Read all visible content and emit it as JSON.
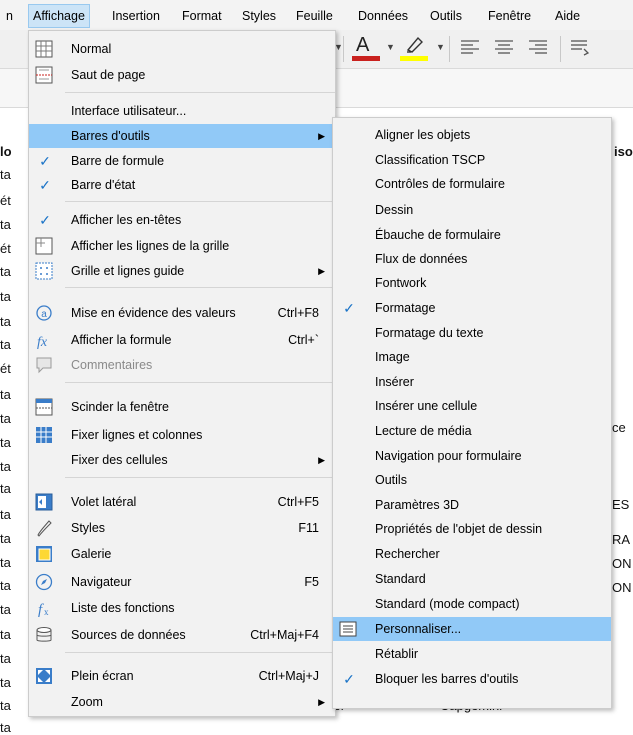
{
  "menubar": {
    "items": [
      "n",
      "Affichage",
      "Insertion",
      "Format",
      "Styles",
      "Feuille",
      "Données",
      "Outils",
      "Fenêtre",
      "Aide"
    ]
  },
  "sheet": {
    "col_header_fragments": [
      "lo",
      "iso"
    ],
    "left_fragments": [
      "ta",
      "ét",
      "ta",
      "ét",
      "ta",
      "ta",
      "ta",
      "ta",
      "ét",
      "ta",
      "ta",
      "ta",
      "ta",
      "ta",
      "ta",
      "ta",
      "ta",
      "ta",
      "ta",
      "ta",
      "ta",
      "ta",
      "ta",
      "ta",
      "ta"
    ],
    "right_fragments": [
      "ce",
      "ES",
      "RA",
      "ON",
      "ON"
    ],
    "bottom_fragments": [
      "raer",
      "Capgemini"
    ]
  },
  "affichage_menu": {
    "items": [
      {
        "label": "Normal",
        "accel": "",
        "icon": "normal-view-icon"
      },
      {
        "label": "Saut de page",
        "accel": "",
        "icon": "page-break-icon"
      },
      {
        "label": "Interface utilisateur...",
        "accel": ""
      },
      {
        "label": "Barres d'outils",
        "accel": "",
        "submenu": true,
        "highlight": true
      },
      {
        "label": "Barre de formule",
        "accel": "",
        "checked": true
      },
      {
        "label": "Barre d'état",
        "accel": "",
        "checked": true
      },
      {
        "label": "Afficher les en-têtes",
        "accel": "",
        "checked": true
      },
      {
        "label": "Afficher les lignes de la grille",
        "accel": "",
        "icon": "grid-lines-icon"
      },
      {
        "label": "Grille et lignes guide",
        "accel": "",
        "icon": "grid-guide-icon",
        "submenu": true
      },
      {
        "label": "Mise en évidence des valeurs",
        "accel": "Ctrl+F8",
        "icon": "value-highlight-icon"
      },
      {
        "label": "Afficher la formule",
        "accel": "Ctrl+`",
        "icon": "formula-icon"
      },
      {
        "label": "Commentaires",
        "accel": "",
        "icon": "comment-icon",
        "disabled": true
      },
      {
        "label": "Scinder la fenêtre",
        "accel": "",
        "icon": "split-window-icon"
      },
      {
        "label": "Fixer lignes et colonnes",
        "accel": "",
        "icon": "freeze-icon"
      },
      {
        "label": "Fixer des cellules",
        "accel": "",
        "submenu": true
      },
      {
        "label": "Volet latéral",
        "accel": "Ctrl+F5",
        "icon": "sidebar-icon"
      },
      {
        "label": "Styles",
        "accel": "F11",
        "icon": "styles-icon"
      },
      {
        "label": "Galerie",
        "accel": "",
        "icon": "gallery-icon"
      },
      {
        "label": "Navigateur",
        "accel": "F5",
        "icon": "navigator-icon"
      },
      {
        "label": "Liste des fonctions",
        "accel": "",
        "icon": "function-list-icon"
      },
      {
        "label": "Sources de données",
        "accel": "Ctrl+Maj+F4",
        "icon": "data-sources-icon"
      },
      {
        "label": "Plein écran",
        "accel": "Ctrl+Maj+J",
        "icon": "fullscreen-icon"
      },
      {
        "label": "Zoom",
        "accel": "",
        "submenu": true
      }
    ]
  },
  "toolbars_submenu": {
    "items": [
      {
        "label": "Aligner les objets"
      },
      {
        "label": "Classification TSCP"
      },
      {
        "label": "Contrôles de formulaire"
      },
      {
        "label": "Dessin"
      },
      {
        "label": "Ébauche de formulaire"
      },
      {
        "label": "Flux de données"
      },
      {
        "label": "Fontwork"
      },
      {
        "label": "Formatage",
        "checked": true
      },
      {
        "label": "Formatage du texte"
      },
      {
        "label": "Image"
      },
      {
        "label": "Insérer"
      },
      {
        "label": "Insérer une cellule"
      },
      {
        "label": "Lecture de média"
      },
      {
        "label": "Navigation pour formulaire"
      },
      {
        "label": "Outils"
      },
      {
        "label": "Paramètres 3D"
      },
      {
        "label": "Propriétés de l'objet de dessin"
      },
      {
        "label": "Rechercher"
      },
      {
        "label": "Standard"
      },
      {
        "label": "Standard (mode compact)"
      },
      {
        "label": "Personnaliser...",
        "highlight": true,
        "icon": "customize-icon"
      },
      {
        "label": "Rétablir"
      },
      {
        "label": "Bloquer les barres d'outils",
        "checked": true
      }
    ]
  },
  "colors": {
    "highlight": "#91c9f7",
    "menu_bg": "#f2f2f2",
    "check": "#1a73c7",
    "font_color_red": "#c9211e",
    "highlight_yellow": "#ffff00"
  }
}
